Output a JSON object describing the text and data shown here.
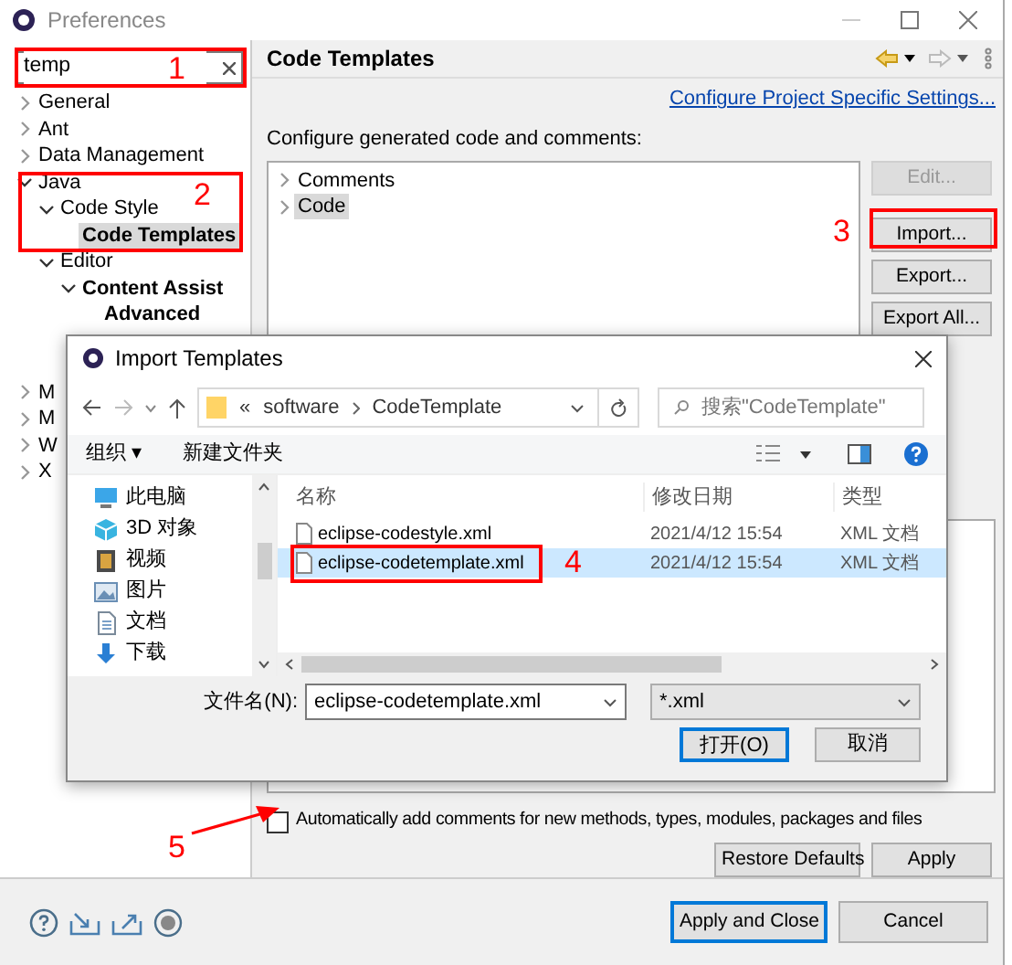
{
  "window": {
    "title": "Preferences"
  },
  "filter": {
    "value": "temp"
  },
  "tree": [
    {
      "label": "General",
      "expanded": false,
      "matched": false,
      "selected": false
    },
    {
      "label": "Ant",
      "expanded": false,
      "matched": false,
      "selected": false
    },
    {
      "label": "Data Management",
      "expanded": false,
      "matched": false,
      "selected": false
    },
    {
      "label": "Java",
      "expanded": true,
      "matched": false,
      "selected": false,
      "children": [
        {
          "label": "Code Style",
          "expanded": true,
          "matched": false,
          "selected": false,
          "children": [
            {
              "label": "Code Templates",
              "matched": true,
              "selected": true
            }
          ]
        },
        {
          "label": "Editor",
          "expanded": true,
          "matched": false,
          "selected": false,
          "children": [
            {
              "label": "Content Assist",
              "expanded": true,
              "matched": true,
              "selected": false,
              "children": [
                {
                  "label": "Advanced",
                  "matched": true,
                  "selected": false
                }
              ]
            }
          ]
        }
      ]
    }
  ],
  "tree_more": [
    {
      "label": "M",
      "expanded": false,
      "selected": false
    },
    {
      "label": "M",
      "expanded": false,
      "selected": false
    },
    {
      "label": "W",
      "expanded": false,
      "selected": false
    },
    {
      "label": "X",
      "expanded": false,
      "selected": false
    }
  ],
  "page": {
    "title": "Code Templates",
    "link": "Configure Project Specific Settings...",
    "description": "Configure generated code and comments:",
    "templates": [
      {
        "label": "Comments",
        "selected": false
      },
      {
        "label": "Code",
        "selected": true
      }
    ],
    "side_buttons": [
      {
        "label": "Edit...",
        "disabled": true
      },
      {
        "label": "Import...",
        "disabled": false
      },
      {
        "label": "Export...",
        "disabled": false
      },
      {
        "label": "Export All...",
        "disabled": false
      }
    ],
    "auto_comments": {
      "label": "Automatically add comments for new methods, types, modules, packages and files",
      "checked": false
    },
    "buttons": [
      {
        "label": "Restore Defaults"
      },
      {
        "label": "Apply"
      }
    ]
  },
  "footer_buttons": [
    {
      "label": "Apply and Close",
      "default": true
    },
    {
      "label": "Cancel",
      "default": false
    }
  ],
  "dialog": {
    "title": "Import Templates",
    "path_prefix": "«",
    "path": [
      "software",
      "CodeTemplate"
    ],
    "search_placeholder": "搜索\"CodeTemplate\"",
    "organize": "组织 ▾",
    "new_folder": "新建文件夹",
    "places": [
      {
        "label": "此电脑",
        "kind": "computer"
      },
      {
        "label": "3D 对象",
        "kind": "cube"
      },
      {
        "label": "视频",
        "kind": "video"
      },
      {
        "label": "图片",
        "kind": "pictures"
      },
      {
        "label": "文档",
        "kind": "documents"
      },
      {
        "label": "下载",
        "kind": "downloads"
      }
    ],
    "columns": [
      "名称",
      "修改日期",
      "类型"
    ],
    "files": [
      {
        "name": "eclipse-codestyle.xml",
        "date": "2021/4/12 15:54",
        "type": "XML 文档",
        "selected": false
      },
      {
        "name": "eclipse-codetemplate.xml",
        "date": "2021/4/12 15:54",
        "type": "XML 文档",
        "selected": true
      }
    ],
    "filename_label": "文件名(N):",
    "filename": "eclipse-codetemplate.xml",
    "file_type": "*.xml",
    "buttons": [
      {
        "label": "打开(O)",
        "default": true
      },
      {
        "label": "取消",
        "default": false
      }
    ]
  },
  "annotations": [
    {
      "label": "1"
    },
    {
      "label": "2"
    },
    {
      "label": "3"
    },
    {
      "label": "4"
    },
    {
      "label": "5"
    }
  ]
}
